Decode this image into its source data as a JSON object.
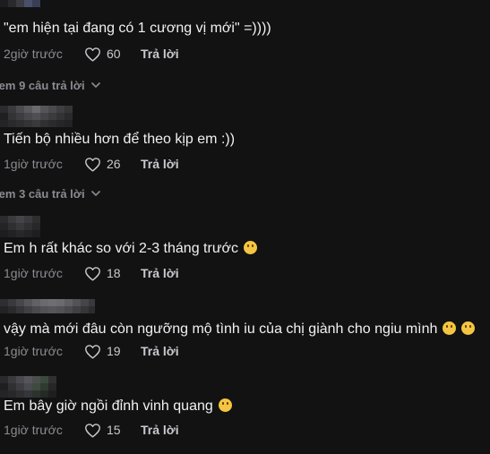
{
  "comments": [
    {
      "text": "\"em hiện tại đang có 1 cương vị mới\" =))))",
      "time": "2giờ trước",
      "likes": "60",
      "reply_label": "Trả lời",
      "view_replies": "Xem 9 câu trả lời"
    },
    {
      "text": "Tiến bộ nhiều hơn để theo kịp em :))",
      "time": "1giờ trước",
      "likes": "26",
      "reply_label": "Trả lời",
      "view_replies": "Xem 3 câu trả lời"
    },
    {
      "text": "Em h rất khác so với 2-3 tháng trước",
      "emojis": [
        "grinning-sweat-emoji"
      ],
      "time": "1giờ trước",
      "likes": "18",
      "reply_label": "Trả lời"
    },
    {
      "text": "vậy mà mới đâu còn ngưỡng mộ tình iu của chị giành cho ngiu mình",
      "emojis": [
        "frowning-emoji",
        "weary-emoji"
      ],
      "time": "1giờ trước",
      "likes": "19",
      "reply_label": "Trả lời"
    },
    {
      "text": "Em bây giờ ngồi đỉnh vinh quang",
      "emojis": [
        "pensive-emoji"
      ],
      "time": "1giờ trước",
      "likes": "15",
      "reply_label": "Trả lời"
    }
  ],
  "icons": {
    "like": "heart-outline-icon",
    "expand": "chevron-down-icon"
  },
  "colors": {
    "background": "#121212",
    "text": "#f1f1f2",
    "muted": "#8a8b91"
  }
}
